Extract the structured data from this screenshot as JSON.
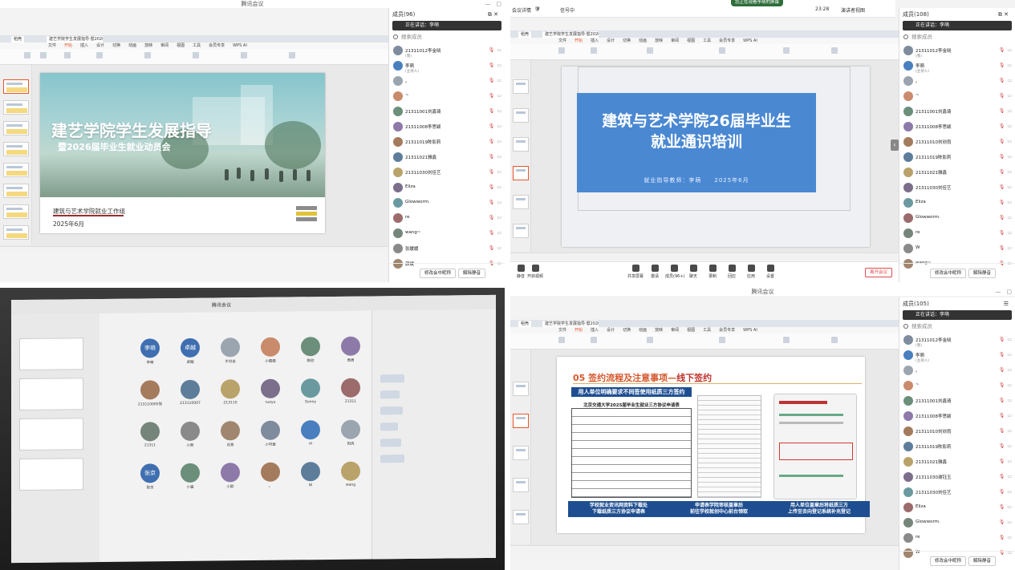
{
  "q1": {
    "window_title": "腾讯会议",
    "ppt_tabs": [
      "稻壳",
      "建艺学院学生发展指导·暨2026届..."
    ],
    "ppt_menu": [
      "文件",
      "开始",
      "插入",
      "设计",
      "切换",
      "动画",
      "放映",
      "审阅",
      "视图",
      "工具",
      "会员专享",
      "WPS AI"
    ],
    "ppt_active_menu": "开始",
    "slide": {
      "title": "建艺学院学生发展指导",
      "subtitle": "暨2026届毕业生就业动员会",
      "org": "建筑与艺术学院就业工作组",
      "date": "2025年6月"
    },
    "panel": {
      "header": "成员(96)",
      "speaking": "正在讲话：李萌",
      "search_placeholder": "搜索成员",
      "members": [
        {
          "name": "21311012李金晓",
          "sub": "(我)"
        },
        {
          "name": "李萌",
          "sub": "(主持人)"
        },
        {
          "name": "。",
          "sub": ""
        },
        {
          "name": "~",
          "sub": ""
        },
        {
          "name": "21311001刘鑫琦",
          "sub": ""
        },
        {
          "name": "21311008李思颖",
          "sub": ""
        },
        {
          "name": "21311019陈影莉",
          "sub": ""
        },
        {
          "name": "21311021雅鑫",
          "sub": ""
        },
        {
          "name": "21311030刘佳艺",
          "sub": ""
        },
        {
          "name": "Eliza",
          "sub": ""
        },
        {
          "name": "Glowworm.",
          "sub": ""
        },
        {
          "name": "re",
          "sub": ""
        },
        {
          "name": "wang~",
          "sub": ""
        },
        {
          "name": "张媛媛",
          "sub": ""
        },
        {
          "name": "颜斌",
          "sub": ""
        }
      ],
      "rename_button": "修改会中昵称",
      "unmute_button": "解除静音"
    }
  },
  "q2": {
    "meeting_info": "会议详情",
    "network": "信号中",
    "share_notice": "您正在观看李萌的屏幕",
    "time": "23:28",
    "view_mode": "演讲者视图",
    "slide": {
      "title_line1": "建筑与艺术学院26届毕业生",
      "title_line2": "就业通识培训",
      "meta": "就业指导教师：李萌　　2025年6月"
    },
    "toolbar": [
      {
        "label": "共享屏幕"
      },
      {
        "label": "邀请"
      },
      {
        "label": "成员(96+)"
      },
      {
        "label": "聊天"
      },
      {
        "label": "录制"
      },
      {
        "label": "回应"
      },
      {
        "label": "应用"
      },
      {
        "label": "设置"
      }
    ],
    "left_tools": [
      "静音",
      "开启视频"
    ],
    "end_button": "离开会议",
    "panel": {
      "header": "成员(108)",
      "speaking": "正在讲话：李萌",
      "search_placeholder": "搜索成员",
      "members": [
        {
          "name": "21311012李金晓",
          "sub": "(我)"
        },
        {
          "name": "李萌",
          "sub": "(主持人)"
        },
        {
          "name": "。",
          "sub": ""
        },
        {
          "name": "~",
          "sub": ""
        },
        {
          "name": "21311001刘鑫琦",
          "sub": ""
        },
        {
          "name": "21311008李思颖",
          "sub": ""
        },
        {
          "name": "21311010刘欣雨",
          "sub": ""
        },
        {
          "name": "21311019陈影莉",
          "sub": ""
        },
        {
          "name": "21311021雅鑫",
          "sub": ""
        },
        {
          "name": "21311030刘佳艺",
          "sub": ""
        },
        {
          "name": "Eliza",
          "sub": ""
        },
        {
          "name": "Glowworm.",
          "sub": ""
        },
        {
          "name": "re",
          "sub": ""
        },
        {
          "name": "W",
          "sub": ""
        },
        {
          "name": "wang~",
          "sub": ""
        }
      ],
      "rename_button": "修改会中昵称",
      "unmute_button": "解除静音"
    }
  },
  "q3": {
    "top_label": "腾讯会议",
    "tiles": [
      {
        "avatar": "李萌",
        "name": "李萌"
      },
      {
        "avatar": "卓越",
        "name": "卓越"
      },
      {
        "avatar": "",
        "name": "不可说"
      },
      {
        "avatar": "",
        "name": "小蛋糕"
      },
      {
        "avatar": "",
        "name": "陈欣"
      },
      {
        "avatar": "",
        "name": "周周"
      },
      {
        "avatar": "",
        "name": "213110005张"
      },
      {
        "avatar": "",
        "name": "213110007"
      },
      {
        "avatar": "",
        "name": "213110"
      },
      {
        "avatar": "",
        "name": "ruoyu"
      },
      {
        "avatar": "",
        "name": "Sunny"
      },
      {
        "avatar": "",
        "name": "21311"
      },
      {
        "avatar": "",
        "name": "21311"
      },
      {
        "avatar": "",
        "name": "小熊"
      },
      {
        "avatar": "",
        "name": "月亮"
      },
      {
        "avatar": "",
        "name": "小可爱"
      },
      {
        "avatar": "",
        "name": "ai"
      },
      {
        "avatar": "",
        "name": "肉肉"
      },
      {
        "avatar": "张京",
        "name": "张京"
      },
      {
        "avatar": "",
        "name": "小猫"
      },
      {
        "avatar": "",
        "name": "小欧"
      },
      {
        "avatar": "",
        "name": "。"
      },
      {
        "avatar": "",
        "name": "W"
      },
      {
        "avatar": "",
        "name": "wang"
      }
    ]
  },
  "q4": {
    "window_title": "腾讯会议",
    "slide": {
      "heading": "05 签约流程及注意事项—",
      "heading_em": "线下签约",
      "banner": "用人单位明确要求不同签使用纸质三方签约",
      "form_title": "北京交通大学2025届毕业生就业三方协议申请表",
      "bottom": [
        "学校就业资讯网资料下载处\n下载纸质三方协议申请表",
        "申请表学院审核盖章后\n前往学校就创中心前台领取",
        "用人单位盖章后将纸质三方\n上传至去向登记系统补充登记"
      ]
    },
    "panel": {
      "header": "成员(105)",
      "speaking": "正在讲话：李萌",
      "search_placeholder": "搜索成员",
      "members": [
        {
          "name": "21311012李金晓",
          "sub": "(我)"
        },
        {
          "name": "李萌",
          "sub": "(主持人)"
        },
        {
          "name": "。",
          "sub": ""
        },
        {
          "name": "~",
          "sub": ""
        },
        {
          "name": "21311001刘鑫琦",
          "sub": ""
        },
        {
          "name": "21311008李思颖",
          "sub": ""
        },
        {
          "name": "21311010刘欣雨",
          "sub": ""
        },
        {
          "name": "21311019陈影莉",
          "sub": ""
        },
        {
          "name": "21311021雅鑫",
          "sub": ""
        },
        {
          "name": "21311030谢钰玉",
          "sub": ""
        },
        {
          "name": "21311030刘佳艺",
          "sub": ""
        },
        {
          "name": "Eliza",
          "sub": ""
        },
        {
          "name": "Glowworm.",
          "sub": ""
        },
        {
          "name": "re",
          "sub": ""
        },
        {
          "name": "W",
          "sub": ""
        }
      ],
      "rename_button": "修改会中昵称",
      "unmute_button": "解除静音"
    }
  },
  "colors": {
    "accent_blue": "#4a88d2",
    "navy": "#1e4e91",
    "wps_orange": "#e8562a",
    "mute_red": "#d04040"
  }
}
